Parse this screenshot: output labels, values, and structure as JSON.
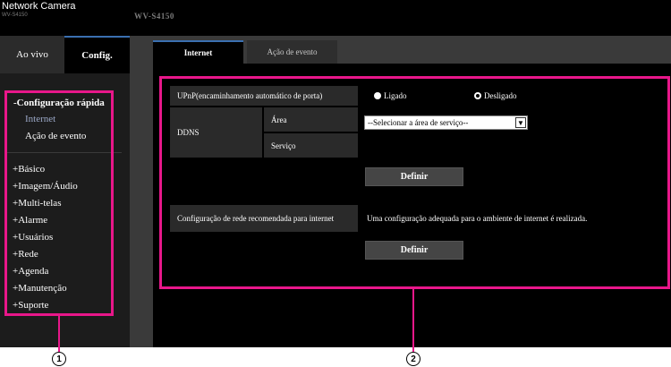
{
  "header": {
    "brand": "Network Camera",
    "brand_model": "WV-S4150",
    "model": "WV-S4150"
  },
  "top_tabs": {
    "live": "Ao vivo",
    "config": "Config."
  },
  "sidebar": {
    "quick_setup": "-Configuração rápida",
    "quick_items": [
      "Internet",
      "Ação de evento"
    ],
    "items": [
      "+Básico",
      "+Imagem/Áudio",
      "+Multi-telas",
      "+Alarme",
      "+Usuários",
      "+Rede",
      "+Agenda",
      "+Manutenção",
      "+Suporte"
    ]
  },
  "main_tabs": [
    "Internet",
    "Ação de evento"
  ],
  "form": {
    "upnp_label": "UPnP(encaminhamento automático de porta)",
    "upnp_on": "Ligado",
    "upnp_off": "Desligado",
    "upnp_selected": "Desligado",
    "ddns_label": "DDNS",
    "area_label": "Área",
    "area_value": "--Selecionar a área de serviço--",
    "service_label": "Serviço",
    "service_value": "",
    "set_button": "Definir",
    "recommended_label": "Configuração de rede recomendada para internet",
    "recommended_text": "Uma configuração adequada para o ambiente de internet é realizada.",
    "set_button2": "Definir"
  },
  "callouts": [
    "1",
    "2"
  ],
  "colors": {
    "highlight": "#e8178a",
    "tab_accent": "#3a6fb0",
    "active_menu": "#9aa7c6"
  }
}
